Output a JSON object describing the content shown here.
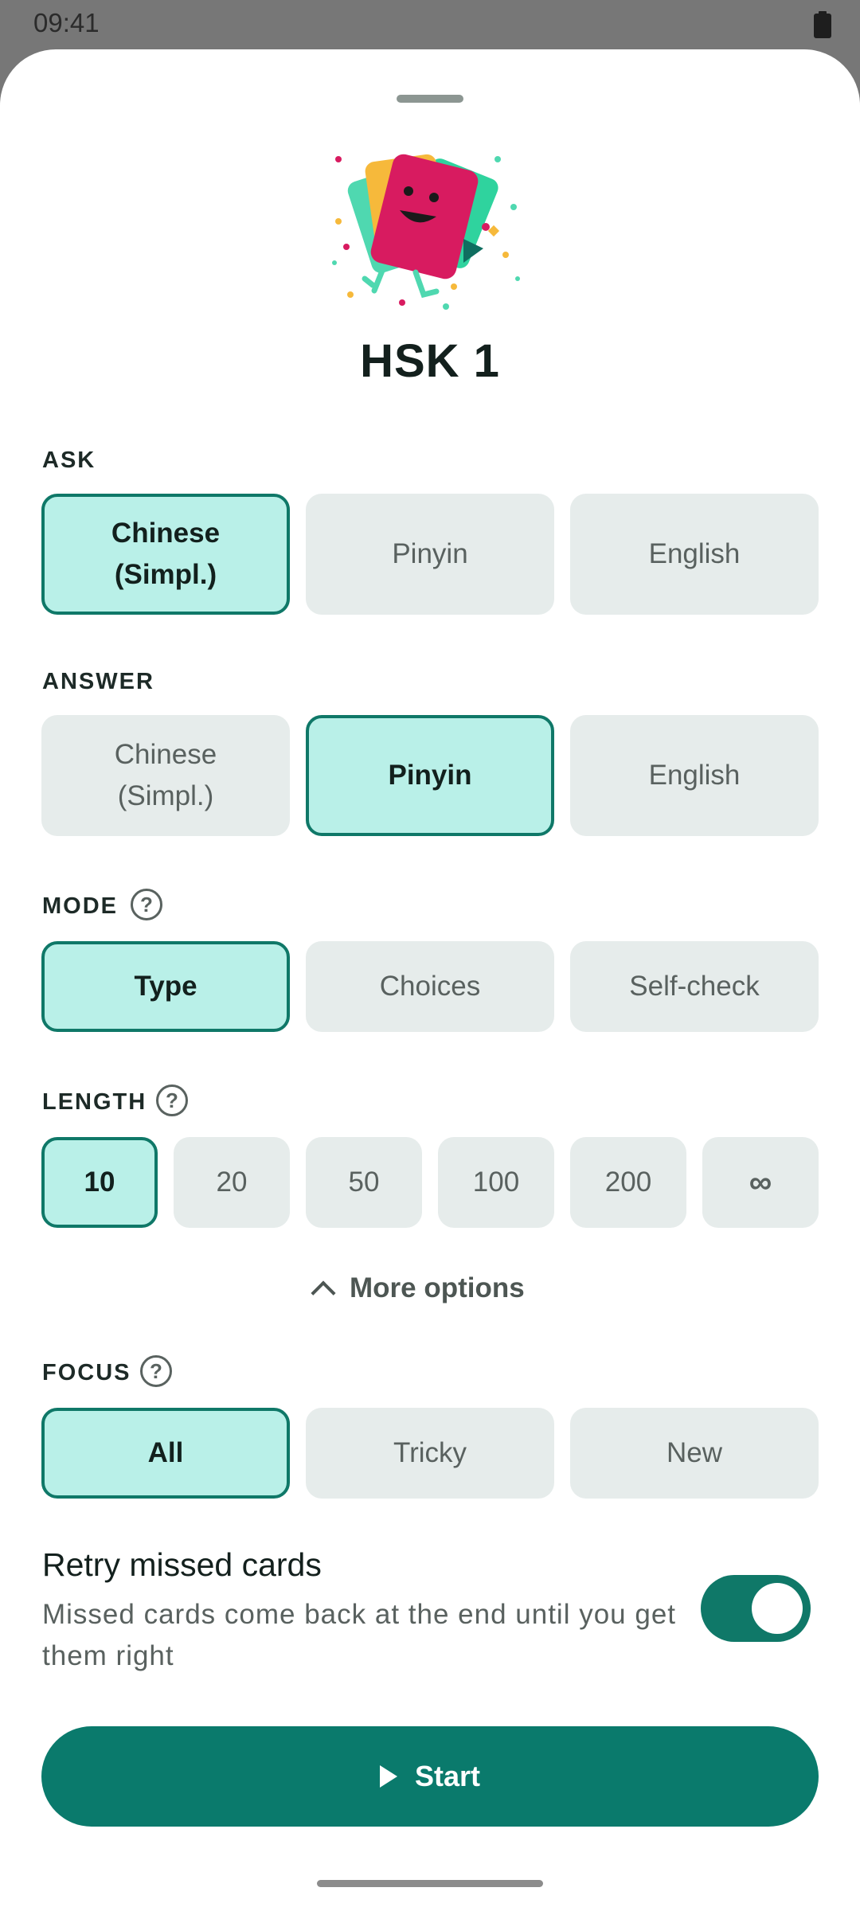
{
  "status_bar": {
    "time": "09:41",
    "battery_icon": "battery-icon"
  },
  "deck": {
    "title": "HSK 1",
    "illustration": "flashcards-illustration"
  },
  "ask": {
    "label": "ASK",
    "options": [
      "Chinese\n(Simpl.)",
      "Pinyin",
      "English"
    ],
    "selected": "Chinese (Simpl.)"
  },
  "answer": {
    "label": "ANSWER",
    "options": [
      "Chinese\n(Simpl.)",
      "Pinyin",
      "English"
    ],
    "selected": "Pinyin"
  },
  "mode": {
    "label": "MODE",
    "help_icon": "help-icon",
    "help_glyph": "?",
    "options": [
      "Type",
      "Choices",
      "Self-check"
    ],
    "selected": "Type"
  },
  "length": {
    "label": "LENGTH",
    "help_icon": "help-icon",
    "help_glyph": "?",
    "options": [
      "10",
      "20",
      "50",
      "100",
      "200",
      "∞"
    ],
    "selected": "10"
  },
  "more_options": {
    "label": "More options",
    "icon": "chevron-up-icon"
  },
  "focus": {
    "label": "FOCUS",
    "help_icon": "help-icon",
    "help_glyph": "?",
    "options": [
      "All",
      "Tricky",
      "New"
    ],
    "selected": "All"
  },
  "retry": {
    "title": "Retry missed cards",
    "description": "Missed cards come back at the end until you get them right",
    "enabled": true
  },
  "start_button": {
    "label": "Start",
    "icon": "play-icon"
  },
  "colors": {
    "accent": "#0f7868",
    "selected_bg": "#b9f0e8",
    "option_bg": "#e6eceb"
  }
}
